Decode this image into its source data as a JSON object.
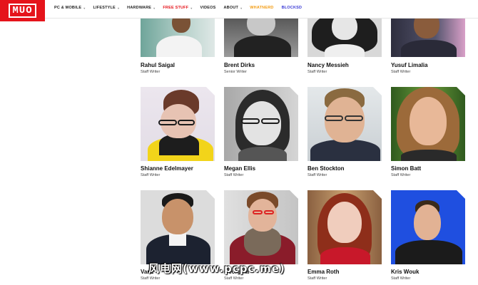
{
  "logo": {
    "text": "MUO"
  },
  "nav": [
    {
      "label": "PC & Mobile",
      "caret": "▾",
      "color": "#222222"
    },
    {
      "label": "Lifestyle",
      "caret": "▾",
      "color": "#222222"
    },
    {
      "label": "Hardware",
      "caret": "▾",
      "color": "#222222"
    },
    {
      "label": "Free Stuff",
      "caret": "▾",
      "color": "#e5141b"
    },
    {
      "label": "Videos",
      "caret": "",
      "color": "#222222"
    },
    {
      "label": "About",
      "caret": "▾",
      "color": "#222222"
    },
    {
      "label": "Whatnerd",
      "caret": "",
      "color": "#f39c12"
    },
    {
      "label": "Blocksd",
      "caret": "",
      "color": "#3b3bd6"
    }
  ],
  "writers": [
    {
      "name": "Rahul Saigal",
      "role": "Staff Writer"
    },
    {
      "name": "Brent Dirks",
      "role": "Senior Writer"
    },
    {
      "name": "Nancy Messieh",
      "role": "Staff Writer"
    },
    {
      "name": "Yusuf Limalia",
      "role": "Staff Writer"
    },
    {
      "name": "Shianne Edelmayer",
      "role": "Staff Writer"
    },
    {
      "name": "Megan Ellis",
      "role": "Staff Writer"
    },
    {
      "name": "Ben Stockton",
      "role": "Staff Writer"
    },
    {
      "name": "Simon Batt",
      "role": "Staff Writer"
    },
    {
      "name": "Vanz",
      "role": "Staff Writer"
    },
    {
      "name": "Georgina",
      "role": "Staff Writer"
    },
    {
      "name": "Emma Roth",
      "role": "Staff Writer"
    },
    {
      "name": "Kris Wouk",
      "role": "Staff Writer"
    }
  ],
  "watermark": "drawn over the bottom of the page",
  "watermark_text": "风电网(www.pcpc.me)"
}
